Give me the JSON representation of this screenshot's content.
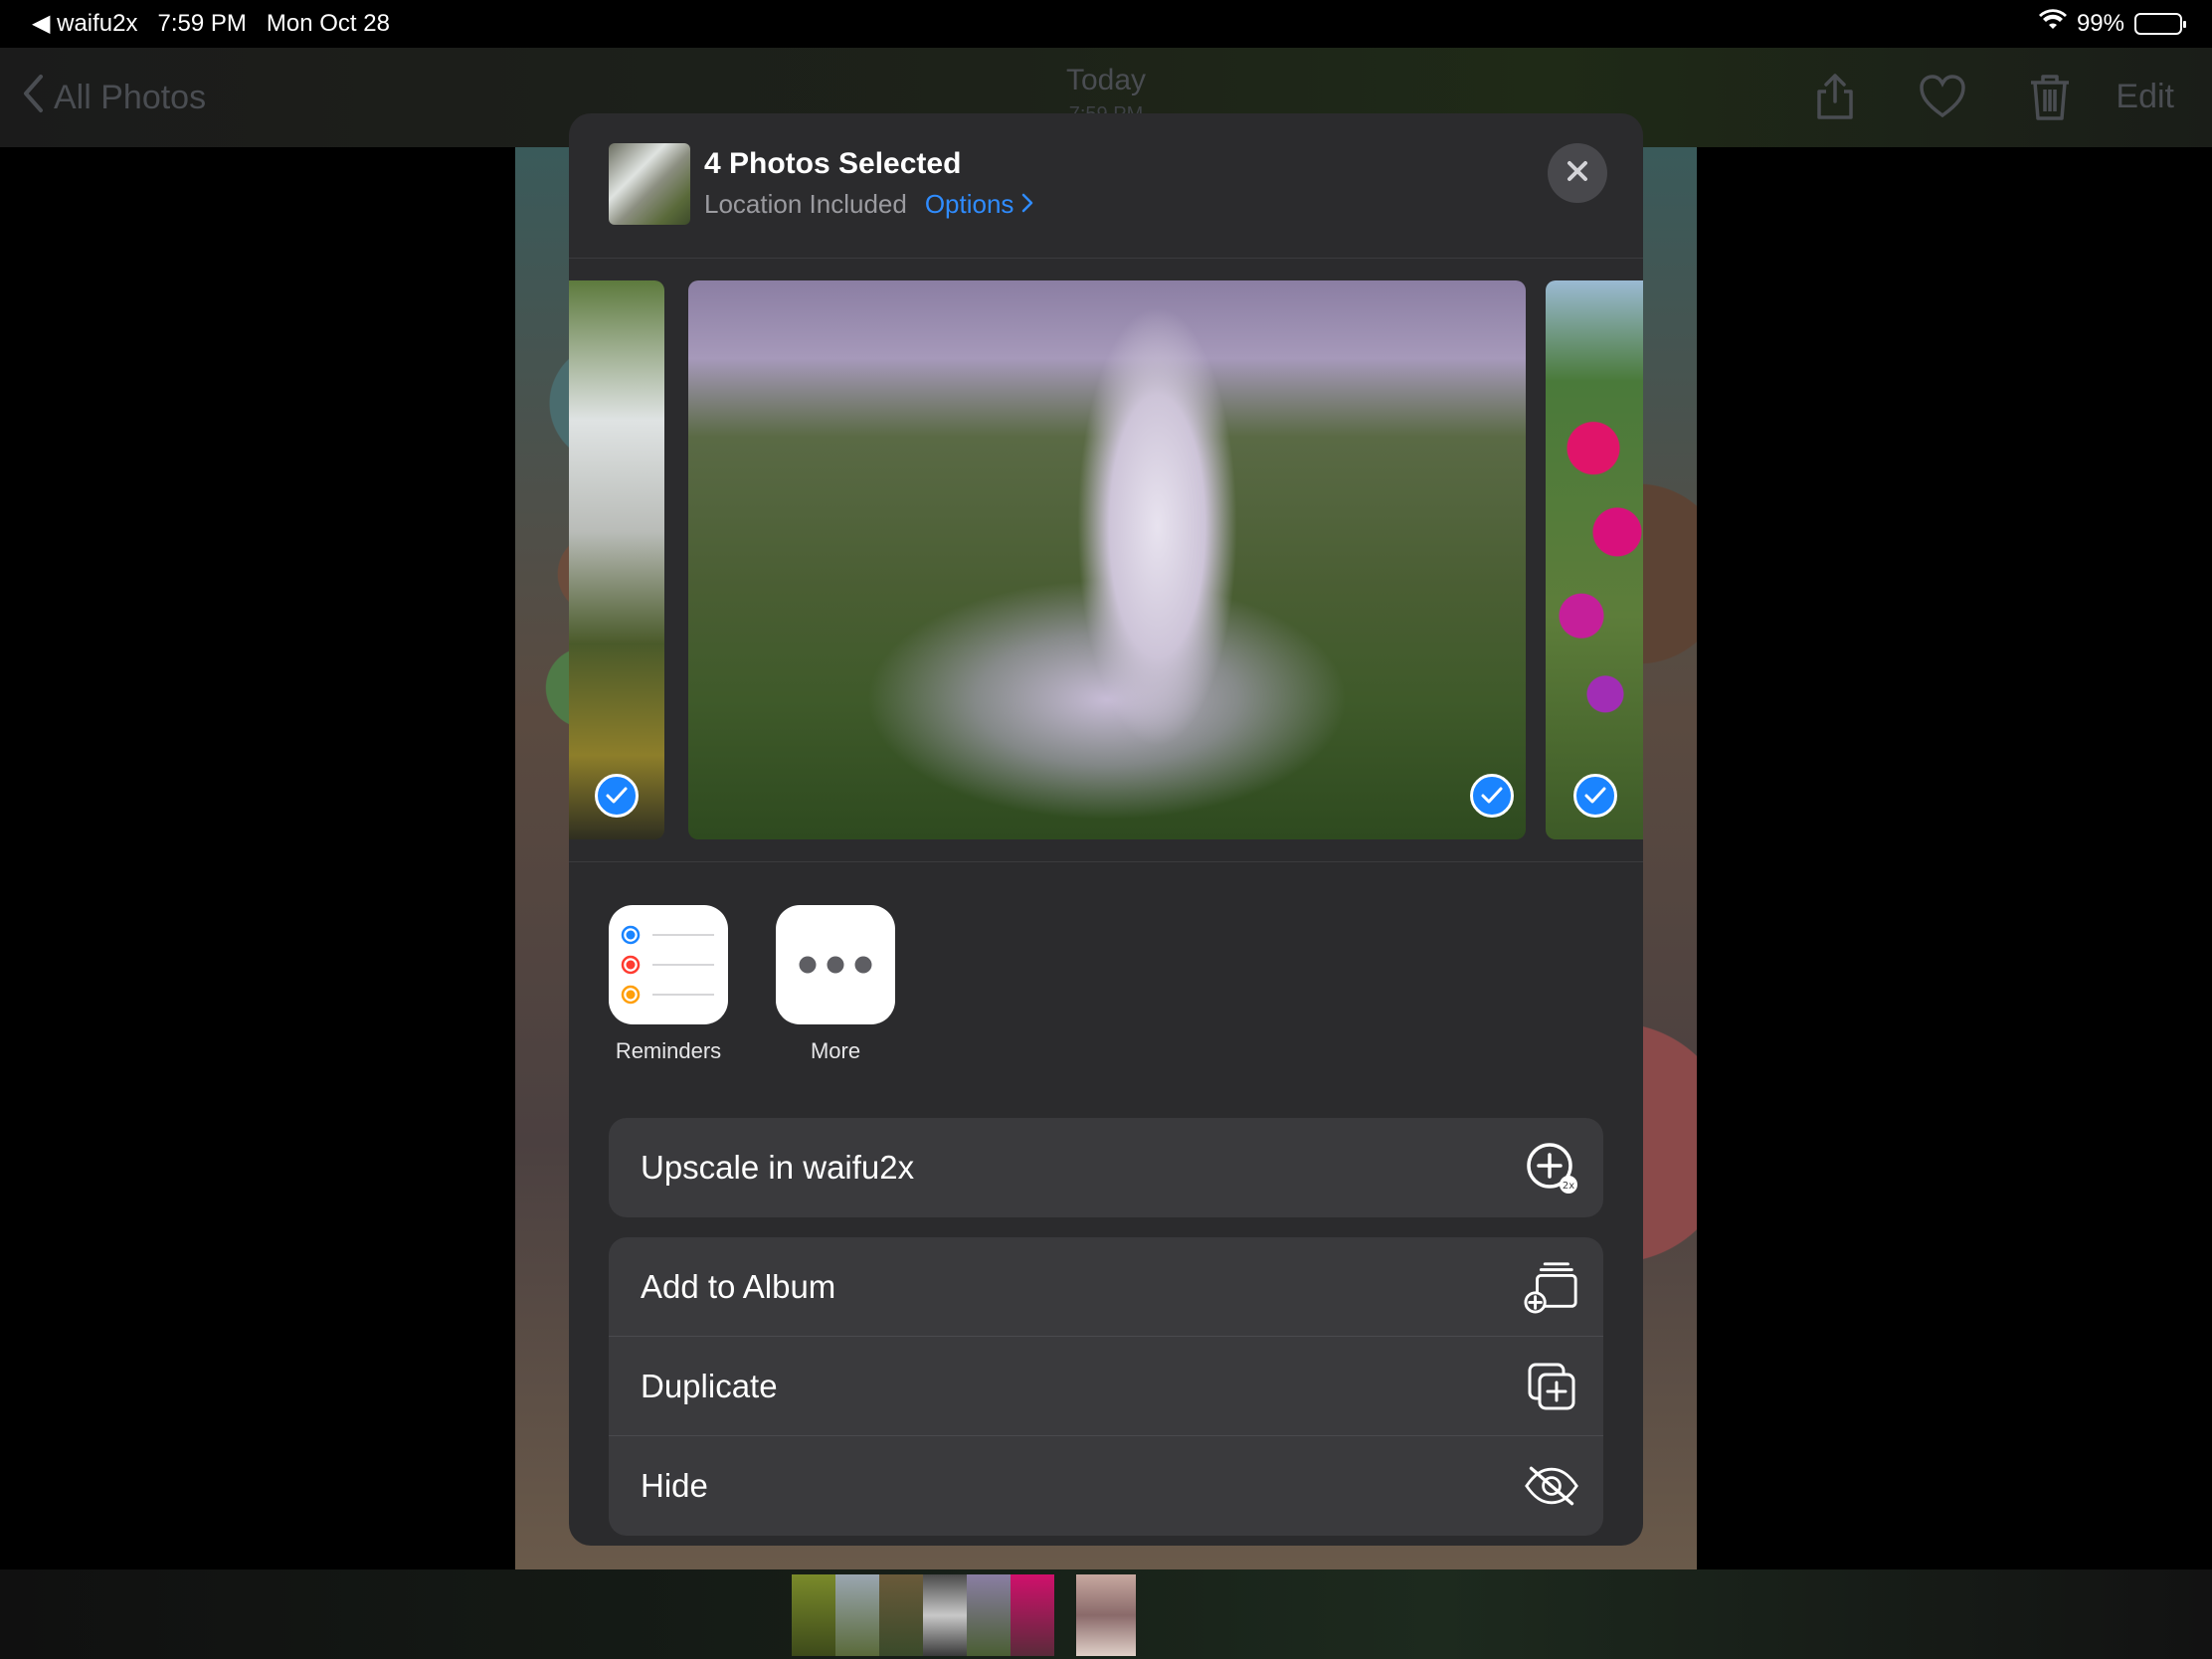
{
  "status_bar": {
    "back_app": "◀ waifu2x",
    "time": "7:59 PM",
    "date": "Mon Oct 28",
    "battery": "99%"
  },
  "nav": {
    "back_label": "All Photos",
    "title": "Today",
    "subtitle": "7:59 PM",
    "edit_label": "Edit"
  },
  "share_sheet": {
    "title": "4 Photos Selected",
    "subtitle": "Location Included",
    "options_label": "Options",
    "apps": [
      {
        "label": "Reminders",
        "icon": "reminders-icon"
      },
      {
        "label": "More",
        "icon": "more-icon"
      }
    ],
    "actions_primary": [
      {
        "label": "Upscale in waifu2x",
        "icon": "upscale-2x-icon"
      }
    ],
    "actions_secondary": [
      {
        "label": "Add to Album",
        "icon": "add-to-album-icon"
      },
      {
        "label": "Duplicate",
        "icon": "duplicate-icon"
      },
      {
        "label": "Hide",
        "icon": "hide-eye-icon"
      }
    ]
  },
  "colors": {
    "accent": "#1a84ff",
    "link": "#2f8cff",
    "sheet_bg": "#2b2b2d",
    "row_bg": "#3a3a3d"
  }
}
